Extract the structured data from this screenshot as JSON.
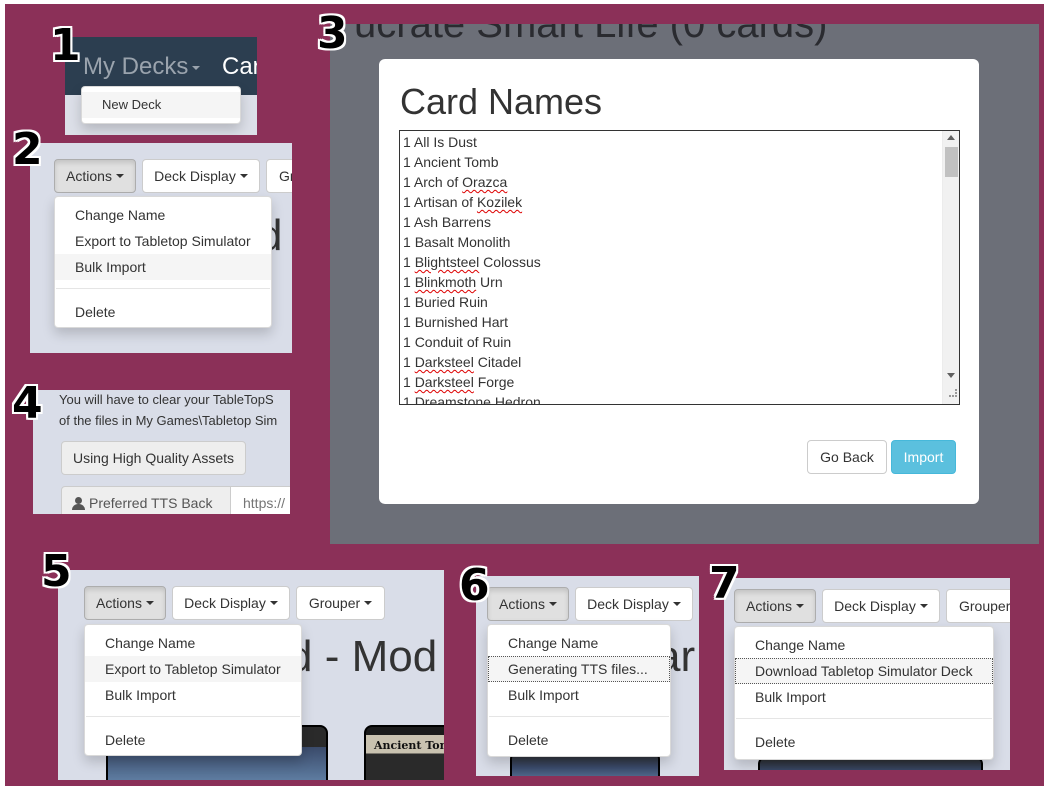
{
  "labels": {
    "n1": "1",
    "n2": "2",
    "n3": "3",
    "n4": "4",
    "n5": "5",
    "n6": "6",
    "n7": "7"
  },
  "p1": {
    "my_decks": "My Decks",
    "cards_partial": "Car",
    "new_deck": "New Deck"
  },
  "p2": {
    "actions": "Actions",
    "deck_display": "Deck Display",
    "grouper_partial": "Gr",
    "menu": [
      "Change Name",
      "Export to Tabletop Simulator",
      "Bulk Import",
      "Delete"
    ],
    "bg_text": "d"
  },
  "p3": {
    "bg_title": "ucrate Smart Life (0 cards)",
    "modal_title": "Card Names",
    "lines": [
      {
        "q": "1",
        "a": "All Is Dust",
        "b": ""
      },
      {
        "q": "1",
        "a": "Ancient Tomb",
        "b": ""
      },
      {
        "q": "1",
        "a": "Arch of ",
        "b": "Orazca"
      },
      {
        "q": "1",
        "a": "Artisan of ",
        "b": "Kozilek"
      },
      {
        "q": "1",
        "a": "Ash Barrens",
        "b": ""
      },
      {
        "q": "1",
        "a": "Basalt Monolith",
        "b": ""
      },
      {
        "q": "1",
        "a": "",
        "b": "Blightsteel",
        "c": " Colossus"
      },
      {
        "q": "1",
        "a": "",
        "b": "Blinkmoth",
        "c": " Urn"
      },
      {
        "q": "1",
        "a": "Buried Ruin",
        "b": ""
      },
      {
        "q": "1",
        "a": "Burnished Hart",
        "b": ""
      },
      {
        "q": "1",
        "a": "Conduit of Ruin",
        "b": ""
      },
      {
        "q": "1",
        "a": "",
        "b": "Darksteel",
        "c": " Citadel"
      },
      {
        "q": "1",
        "a": "",
        "b": "Darksteel",
        "c": " Forge"
      },
      {
        "q": "1",
        "a": "",
        "b": "Dreamstone",
        "c": " Hedron"
      }
    ],
    "go_back": "Go Back",
    "import": "Import"
  },
  "p4": {
    "line1": "You will have to clear your TableTopS",
    "line2": "of the files in My Games\\Tabletop Sim",
    "hq_button": "Using High Quality Assets",
    "pref_label": "Preferred TTS Back",
    "pref_placeholder": "https://"
  },
  "p5": {
    "actions": "Actions",
    "deck_display": "Deck Display",
    "grouper": "Grouper",
    "menu": [
      "Change Name",
      "Export to Tabletop Simulator",
      "Bulk Import",
      "Delete"
    ],
    "bg_text": "d - Mod",
    "card_label": "Ancient Tom"
  },
  "p6": {
    "actions": "Actions",
    "deck_display": "Deck Display",
    "menu": [
      "Change Name",
      "Generating TTS files...",
      "Bulk Import",
      "Delete"
    ],
    "bg_text": "ar"
  },
  "p7": {
    "actions": "Actions",
    "deck_display": "Deck Display",
    "grouper_partial": "Grouper",
    "menu": [
      "Change Name",
      "Download Tabletop Simulator Deck",
      "Bulk Import",
      "Delete"
    ]
  },
  "colors": {
    "background": "#8b3058",
    "import_button": "#5bc0de",
    "navbar": "#2c3e50",
    "modal_overlay": "#6c6f78"
  }
}
